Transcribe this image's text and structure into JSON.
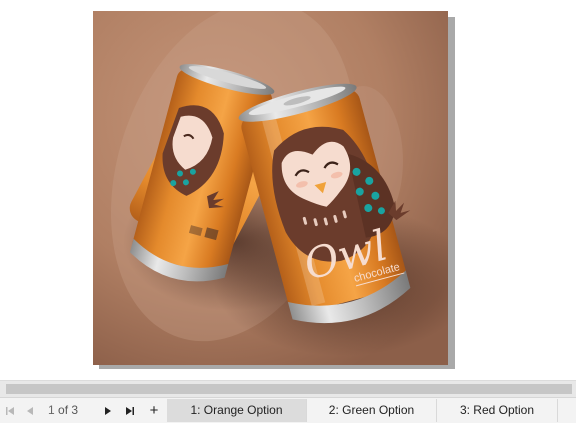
{
  "page_navigator": {
    "current_page": "1",
    "of_label": "of",
    "total_pages": "3",
    "first_icon": "first-page-icon",
    "prev_icon": "previous-page-icon",
    "next_icon": "next-page-icon",
    "last_icon": "last-page-icon",
    "add_icon": "add-page-icon",
    "add_label": "+",
    "tabs": [
      {
        "label": "1: Orange Option",
        "active": true
      },
      {
        "label": "2: Green Option",
        "active": false
      },
      {
        "label": "3: Red Option",
        "active": false
      }
    ]
  },
  "artwork": {
    "brand_script": "Owl",
    "brand_word": "chocolate",
    "colors": {
      "background": "#b5876b",
      "can_orange": "#e0862a",
      "owl_brown": "#6b3c2c",
      "owl_face": "#f6dccf",
      "spots_teal": "#1aa3a0",
      "beak": "#f0a23a"
    }
  }
}
